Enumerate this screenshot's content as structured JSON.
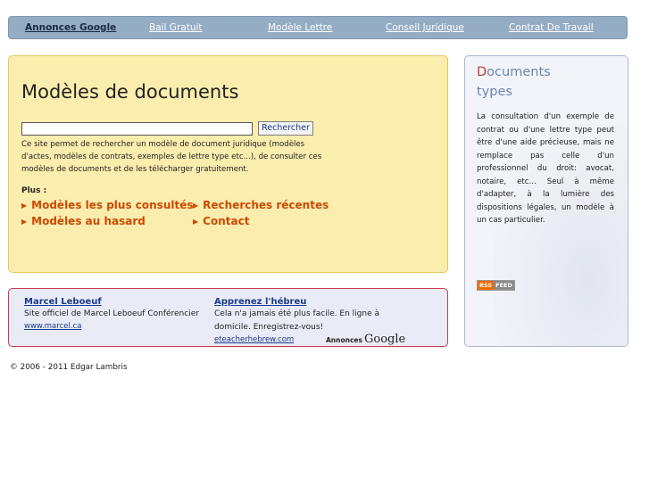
{
  "topnav": {
    "links": [
      "Annonces Google",
      "Bail Gratuit",
      "Modèle Lettre",
      "Conseil Juridique",
      "Contrat De Travail"
    ]
  },
  "main": {
    "title": "Modèles de documents",
    "search": {
      "value": "",
      "button_label": "Rechercher"
    },
    "intro": "Ce site permet de rechercher un modèle de document juridique (modèles d'actes, modèles de contrats, exemples de lettre type etc...), de consulter ces modèles de documents et de les télécharger gratuitement.",
    "plus_label": "Plus :",
    "links": [
      "Modèles les plus consultés",
      "Recherches récentes",
      "Modèles au hasard",
      "Contact"
    ]
  },
  "ads": {
    "items": [
      {
        "title": "Marcel Leboeuf",
        "desc": "Site officiel de Marcel Leboeuf Conférencier",
        "url": "www.marcel.ca"
      },
      {
        "title": "Apprenez l'hébreu",
        "desc": "Cela n'a jamais été plus facile. En ligne à domicile. Enregistrez-vous!",
        "url": "eteacherhebrew.com"
      }
    ],
    "label_small": "Annonces",
    "label_google": "Google"
  },
  "sidebar": {
    "title_first_letter": "D",
    "title_rest": "ocuments",
    "title_line2": "types",
    "text": "La consultation d'un exemple de contrat ou d'une lettre type peut être d'une aide précieuse, mais ne remplace pas celle d'un professionnel du droit: avocat, notaire, etc... Seul à même d'adapter, à la lumière des dispositions légales, un modèle à un cas particulier.",
    "rss_left": "RSS",
    "rss_right": "FEED"
  },
  "footer": {
    "text": "© 2006 - 2011 Edgar Lambris"
  }
}
